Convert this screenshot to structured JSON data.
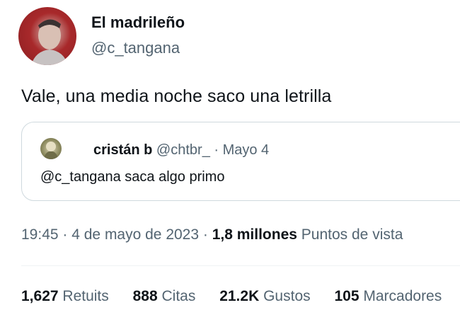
{
  "author": {
    "name": "El madrileño",
    "handle": "@c_tangana"
  },
  "tweet": {
    "text": "Vale, una media noche saco una letrilla"
  },
  "quoted": {
    "name": "cristán b",
    "handle": "@chtbr_",
    "separator": " · ",
    "date": "Mayo 4",
    "text": "@c_tangana saca algo primo"
  },
  "meta": {
    "time": "19:45",
    "sep1": " · ",
    "date": "4 de mayo de 2023",
    "sep2": " · ",
    "views_value": "1,8 millones",
    "views_label": "Puntos de vista"
  },
  "stats": [
    {
      "value": "1,627",
      "label": "Retuits"
    },
    {
      "value": "888",
      "label": "Citas"
    },
    {
      "value": "21.2K",
      "label": "Gustos"
    },
    {
      "value": "105",
      "label": "Marcadores"
    }
  ],
  "colors": {
    "text_primary": "#0f1419",
    "text_secondary": "#536471",
    "border": "#cfd9de",
    "avatar_bg": "#a8292b"
  }
}
